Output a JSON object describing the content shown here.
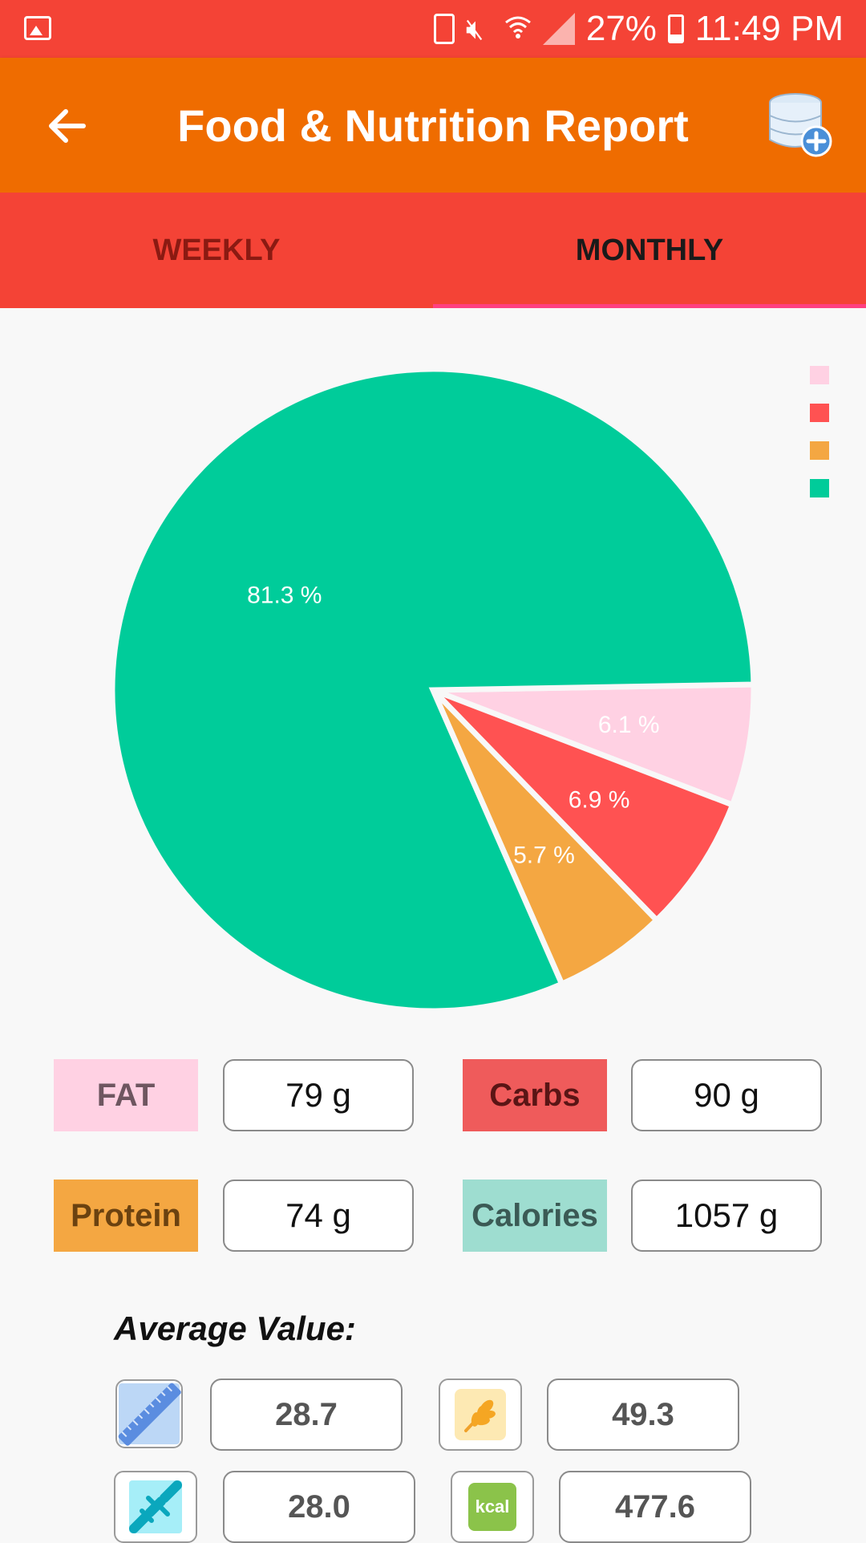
{
  "status_bar": {
    "battery_percent": "27%",
    "time": "11:49 PM",
    "icons": [
      "gallery-icon",
      "battery-saver-icon",
      "mute-icon",
      "wifi-icon",
      "signal-icon",
      "battery-icon"
    ]
  },
  "app_bar": {
    "title": "Food & Nutrition Report",
    "back_icon": "arrow-back-icon",
    "action_icon": "database-add-icon"
  },
  "tabs": [
    {
      "label": "WEEKLY",
      "selected": false
    },
    {
      "label": "MONTHLY",
      "selected": true
    }
  ],
  "chart_data": {
    "type": "pie",
    "slices": [
      {
        "value": 6.1,
        "label": "6.1 %",
        "color": "#ffd1e3"
      },
      {
        "value": 6.9,
        "label": "6.9 %",
        "color": "#ff5252"
      },
      {
        "value": 5.7,
        "label": "5.7 %",
        "color": "#f4a742"
      },
      {
        "value": 81.3,
        "label": "81.3 %",
        "color": "#00cc9a"
      }
    ],
    "legend_placement": "top-right"
  },
  "nutrients": {
    "fat": {
      "label": "FAT",
      "value": "79 g",
      "bg": "#ffd1e3",
      "fg": "#6e5660"
    },
    "carbs": {
      "label": "Carbs",
      "value": "90 g",
      "bg": "#ef5b5b",
      "fg": "#5a1515"
    },
    "protein": {
      "label": "Protein",
      "value": "74 g",
      "bg": "#f4a742",
      "fg": "#6b4210"
    },
    "calories": {
      "label": "Calories",
      "value": "1057 g",
      "bg": "#9eddd0",
      "fg": "#3b5a55"
    }
  },
  "average": {
    "title": "Average Value:",
    "items": [
      {
        "icon": "ruler-icon",
        "value": "28.7"
      },
      {
        "icon": "wheat-icon",
        "value": "49.3"
      },
      {
        "icon": "dna-icon",
        "value": "28.0"
      },
      {
        "icon": "kcal-icon",
        "value": "477.6",
        "icon_text": "kcal"
      }
    ]
  }
}
